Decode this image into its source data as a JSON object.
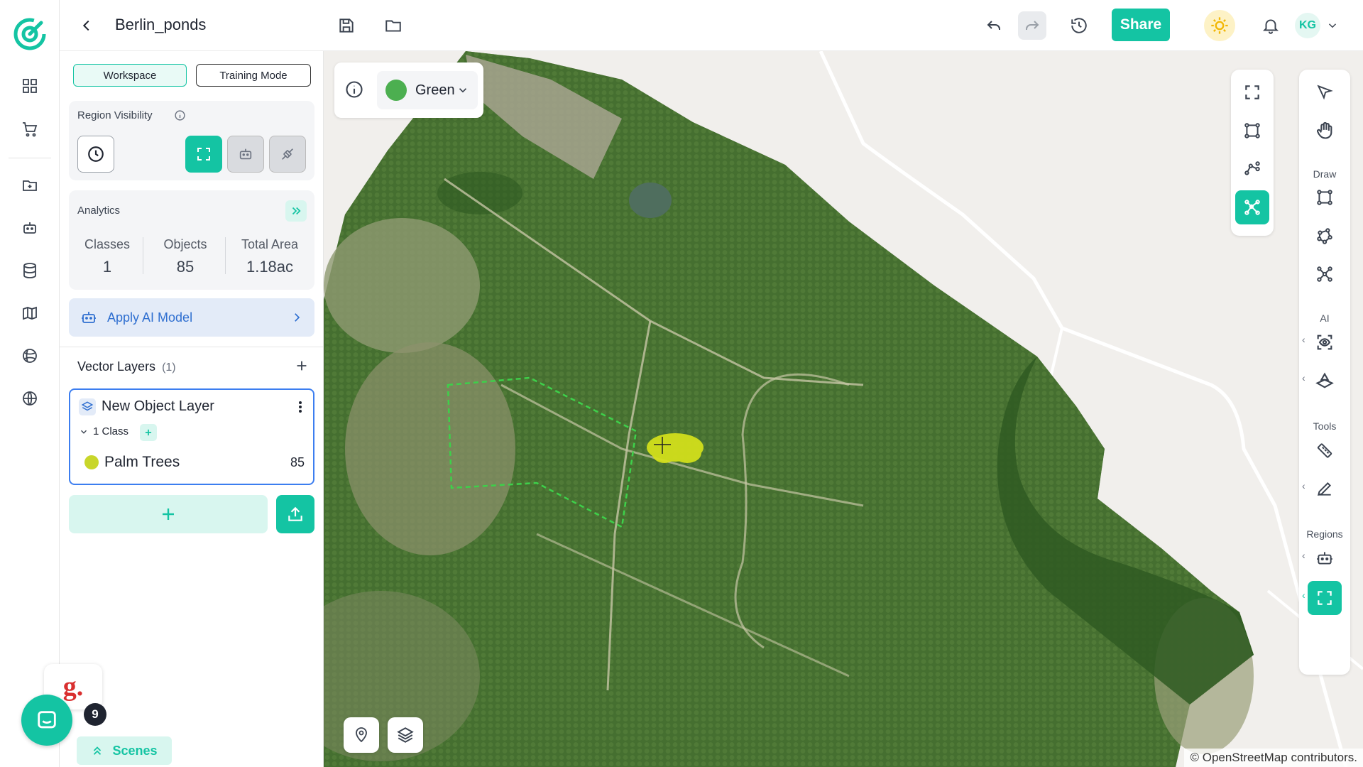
{
  "header": {
    "project_title": "Berlin_ponds",
    "share_label": "Share",
    "avatar_initials": "KG"
  },
  "panel": {
    "workspace_label": "Workspace",
    "training_label": "Training Mode",
    "region_visibility_label": "Region Visibility",
    "analytics_label": "Analytics",
    "stats": {
      "classes_label": "Classes",
      "classes_value": "1",
      "objects_label": "Objects",
      "objects_value": "85",
      "area_label": "Total Area",
      "area_value": "1.18ac"
    },
    "apply_ai_label": "Apply AI Model",
    "vector_layers_label": "Vector Layers",
    "vector_layers_count": "(1)",
    "layer": {
      "name": "New Object Layer",
      "class_count": "1 Class",
      "class_name": "Palm Trees",
      "class_count_value": "85",
      "class_color": "#c8d62a"
    },
    "scenes_label": "Scenes",
    "chat_badge": "9",
    "chat_logo_letter": "g."
  },
  "map": {
    "band_label": "Green",
    "band_color": "#4caf50",
    "attribution": "© OpenStreetMap contributors.",
    "groups": {
      "draw": "Draw",
      "ai": "AI",
      "tools": "Tools",
      "regions": "Regions"
    }
  },
  "colors": {
    "accent": "#14c4a3",
    "selected_border": "#3c7ef0"
  }
}
